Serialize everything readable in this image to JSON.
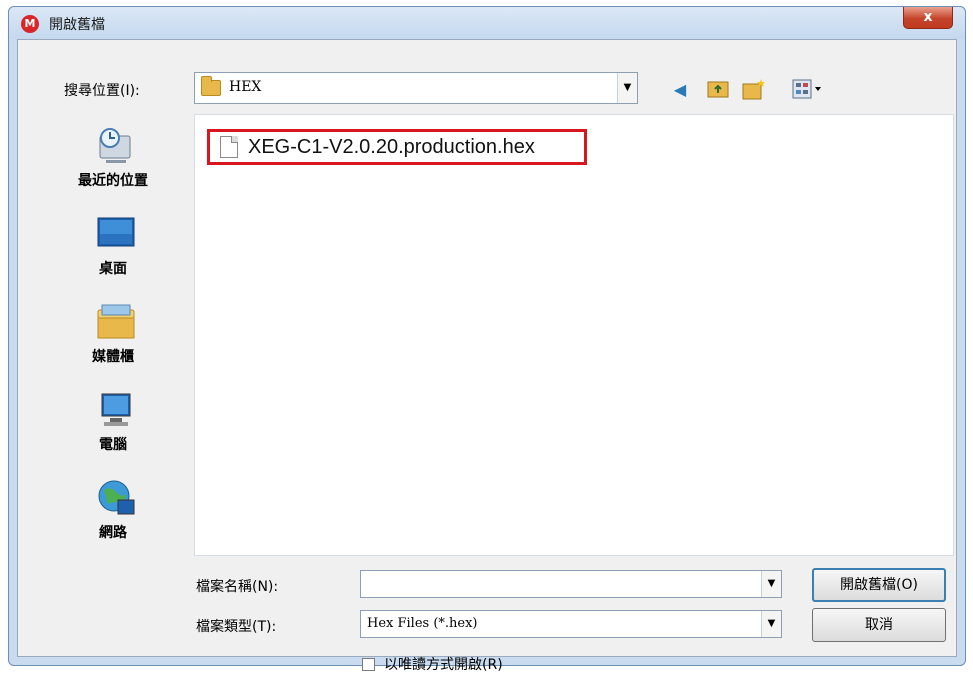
{
  "window": {
    "title": "開啟舊檔",
    "close_label": "x"
  },
  "toolbar": {
    "lookin_label": "搜尋位置(I):",
    "lookin_value": "HEX",
    "back_icon": "back-arrow-icon",
    "up_icon": "up-folder-icon",
    "newfolder_icon": "new-folder-icon",
    "view_icon": "view-menu-icon"
  },
  "places": [
    {
      "label": "最近的位置",
      "icon": "recent-places-icon"
    },
    {
      "label": "桌面",
      "icon": "desktop-icon"
    },
    {
      "label": "媒體櫃",
      "icon": "libraries-icon"
    },
    {
      "label": "電腦",
      "icon": "computer-icon"
    },
    {
      "label": "網路",
      "icon": "network-icon"
    }
  ],
  "files": [
    {
      "name": "XEG-C1-V2.0.20.production.hex"
    }
  ],
  "bottom": {
    "filename_label": "檔案名稱(N):",
    "filename_value": "",
    "filetype_label": "檔案類型(T):",
    "filetype_value": "Hex Files (*.hex)",
    "open_button": "開啟舊檔(O)",
    "cancel_button": "取消",
    "readonly_label": "以唯讀方式開啟(R)"
  },
  "colors": {
    "highlight_border": "#d9161e",
    "title_bar": "#c9dcef"
  }
}
